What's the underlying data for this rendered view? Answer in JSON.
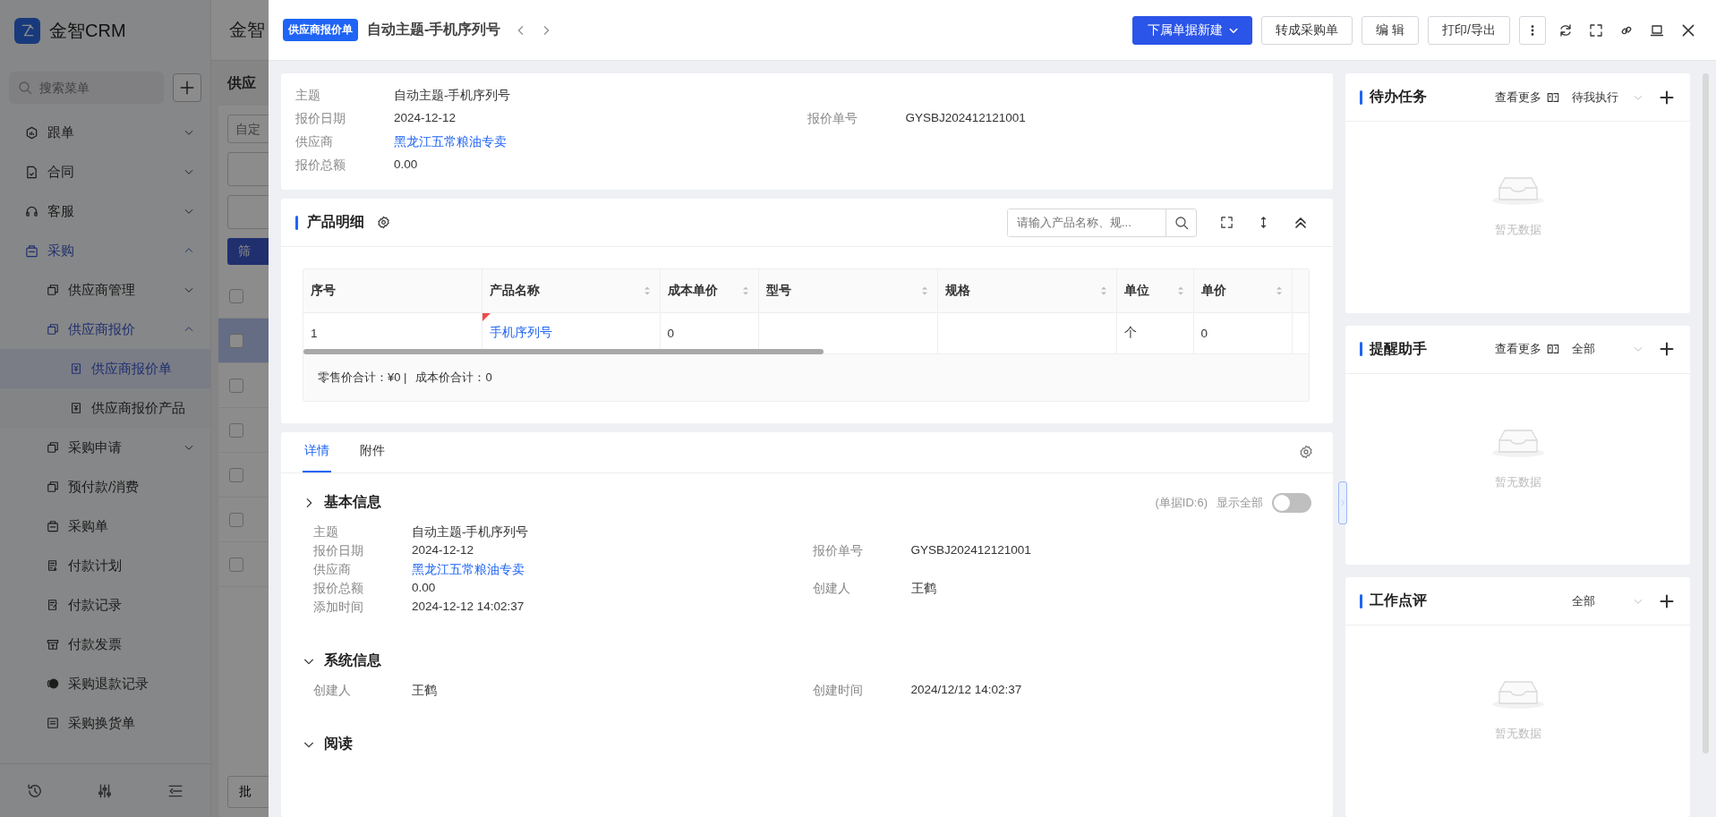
{
  "app": {
    "logo": "金智CRM",
    "header_title": "金智",
    "search_placeholder": "搜索菜单"
  },
  "sidebar": {
    "items": [
      {
        "label": "跟单",
        "expanded": false,
        "selected": false
      },
      {
        "label": "合同",
        "expanded": false,
        "selected": false
      },
      {
        "label": "客服",
        "expanded": false,
        "selected": false
      },
      {
        "label": "采购",
        "expanded": true,
        "selected": false,
        "children": [
          {
            "label": "供应商管理",
            "expanded": false,
            "selected": false
          },
          {
            "label": "供应商报价",
            "expanded": true,
            "selected": false,
            "children": [
              {
                "label": "供应商报价单",
                "selected": true
              },
              {
                "label": "供应商报价产品",
                "selected": false
              }
            ]
          },
          {
            "label": "采购申请",
            "expanded": false,
            "selected": false
          },
          {
            "label": "预付款/消费",
            "selected": false
          },
          {
            "label": "采购单",
            "selected": false
          },
          {
            "label": "付款计划",
            "selected": false
          },
          {
            "label": "付款记录",
            "selected": false
          },
          {
            "label": "付款发票",
            "selected": false
          },
          {
            "label": "采购退款记录",
            "selected": false
          },
          {
            "label": "采购换货单",
            "selected": false
          }
        ]
      }
    ]
  },
  "background_page": {
    "title": "供应",
    "filter_placeholder": "自定",
    "filter_button": "筛",
    "batch_button": "批",
    "header_checked": false,
    "rows": [
      {
        "selected": true,
        "checked": false
      },
      {
        "selected": false,
        "checked": false
      },
      {
        "selected": false,
        "checked": false
      },
      {
        "selected": false,
        "checked": false
      },
      {
        "selected": false,
        "checked": false
      },
      {
        "selected": false,
        "checked": false
      }
    ]
  },
  "drawer": {
    "badge": "供应商报价单",
    "title": "自动主题-手机序列号",
    "buttons": [
      {
        "label": "下属单据新建",
        "kind": "primary"
      },
      {
        "label": "转成采购单",
        "kind": "default"
      },
      {
        "label": "编 辑",
        "kind": "default"
      },
      {
        "label": "打印/导出",
        "kind": "default"
      }
    ]
  },
  "summary": {
    "rows": [
      [
        {
          "label": "主题",
          "value": "自动主题-手机序列号",
          "link": false
        }
      ],
      [
        {
          "label": "报价日期",
          "value": "2024-12-12",
          "link": false
        },
        {
          "label": "报价单号",
          "value": "GYSBJ202412121001",
          "link": false
        }
      ],
      [
        {
          "label": "供应商",
          "value": "黑龙江五常粮油专卖",
          "link": true
        }
      ],
      [
        {
          "label": "报价总额",
          "value": "0.00",
          "link": false
        }
      ]
    ]
  },
  "products": {
    "title": "产品明细",
    "search_placeholder": "请输入产品名称、规...",
    "table": {
      "columns": [
        {
          "label": "序号",
          "sortable": false
        },
        {
          "label": "产品名称",
          "sortable": true
        },
        {
          "label": "成本单价",
          "sortable": true
        },
        {
          "label": "型号",
          "sortable": true
        },
        {
          "label": "规格",
          "sortable": true
        },
        {
          "label": "单位",
          "sortable": true
        },
        {
          "label": "单价",
          "sortable": true
        }
      ],
      "rows": [
        {
          "cells": [
            {
              "text": "1",
              "link": false
            },
            {
              "text": "手机序列号",
              "link": true
            },
            {
              "text": "0",
              "link": false
            },
            null,
            null,
            {
              "text": "个",
              "link": false
            },
            {
              "text": "0",
              "link": false
            }
          ],
          "flagged": true
        }
      ]
    },
    "totals": [
      "零售价合计：¥0 |",
      "成本价合计：0"
    ]
  },
  "details": {
    "tabs": [
      {
        "label": "详情",
        "selected": true
      },
      {
        "label": "附件",
        "selected": false
      }
    ],
    "sections": [
      {
        "title": "基本信息",
        "expanded": false,
        "doc_id": "(单据ID:6)",
        "show_all": "显示全部",
        "show_all_on": false,
        "rows": [
          [
            {
              "label": "主题",
              "value": "自动主题-手机序列号",
              "link": false
            }
          ],
          [
            {
              "label": "报价日期",
              "value": "2024-12-12",
              "link": false
            },
            {
              "label": "报价单号",
              "value": "GYSBJ202412121001",
              "link": false
            }
          ],
          [
            {
              "label": "供应商",
              "value": "黑龙江五常粮油专卖",
              "link": true
            }
          ],
          [
            {
              "label": "报价总额",
              "value": "0.00",
              "link": false
            },
            {
              "label": "创建人",
              "value": "王鹤",
              "link": false
            }
          ],
          [
            {
              "label": "添加时间",
              "value": "2024-12-12 14:02:37",
              "link": false
            }
          ]
        ]
      },
      {
        "title": "系统信息",
        "expanded": true,
        "rows": [
          [
            {
              "label": "创建人",
              "value": "王鹤",
              "link": false
            },
            {
              "label": "创建时间",
              "value": "2024/12/12 14:02:37",
              "link": false
            }
          ]
        ]
      },
      {
        "title": "阅读",
        "expanded": true
      }
    ]
  },
  "side_panels": [
    {
      "title": "待办任务",
      "more": "查看更多",
      "filter": "待我执行",
      "empty": "暂无数据"
    },
    {
      "title": "提醒助手",
      "more": "查看更多",
      "filter": "全部",
      "empty": "暂无数据"
    },
    {
      "title": "工作点评",
      "filter": "全部",
      "empty": "暂无数据"
    }
  ]
}
